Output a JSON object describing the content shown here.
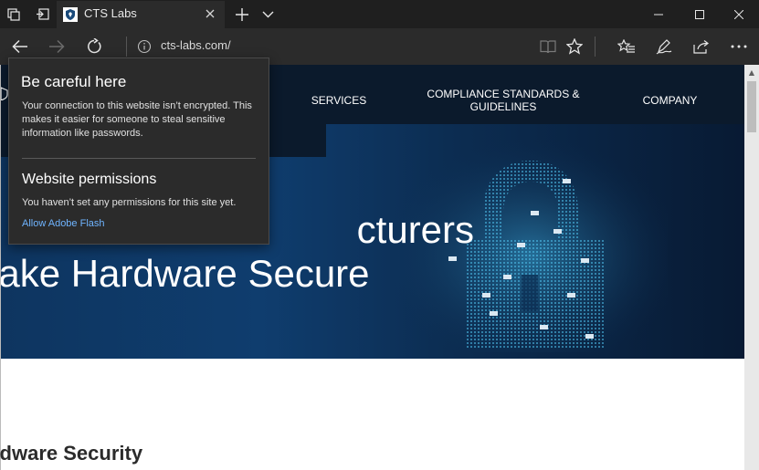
{
  "browser": {
    "tab": {
      "title": "CTS Labs"
    },
    "address": {
      "url": "cts-labs.com/"
    },
    "icons": {
      "tab_preview": "tab-preview-icon",
      "set_aside": "set-aside-tabs-icon",
      "new_tab": "plus-icon",
      "tab_list": "chevron-down-icon",
      "back": "back-arrow-icon",
      "forward": "forward-arrow-icon",
      "refresh": "refresh-icon",
      "info": "info-icon",
      "reading_view": "reading-view-icon",
      "favorite": "star-icon",
      "favorites_hub": "favorites-hub-icon",
      "notes": "pen-icon",
      "share": "share-icon",
      "more": "more-icon"
    },
    "colors": {
      "chrome_dark": "#1f1f1f",
      "toolbar": "#2b2b2b",
      "link": "#6fb4ff"
    }
  },
  "site": {
    "nav": {
      "services": "SERVICES",
      "compliance_line1": "COMPLIANCE STANDARDS &",
      "compliance_line2": "GUIDELINES",
      "company": "COMPANY"
    },
    "hero": {
      "line1": "elping Manufacturers",
      "line1_visible": "cturers",
      "line2": "Make Hardware Secure",
      "line2_visible": "lake Hardware Secure"
    },
    "section_title": "rdware Security"
  },
  "flyout": {
    "title": "Be careful here",
    "body": "Your connection to this website isn’t encrypted. This makes it easier for someone to steal sensitive information like passwords.",
    "permissions_title": "Website permissions",
    "permissions_body": "You haven’t set any permissions for this site yet.",
    "permission_link": "Allow Adobe Flash"
  }
}
